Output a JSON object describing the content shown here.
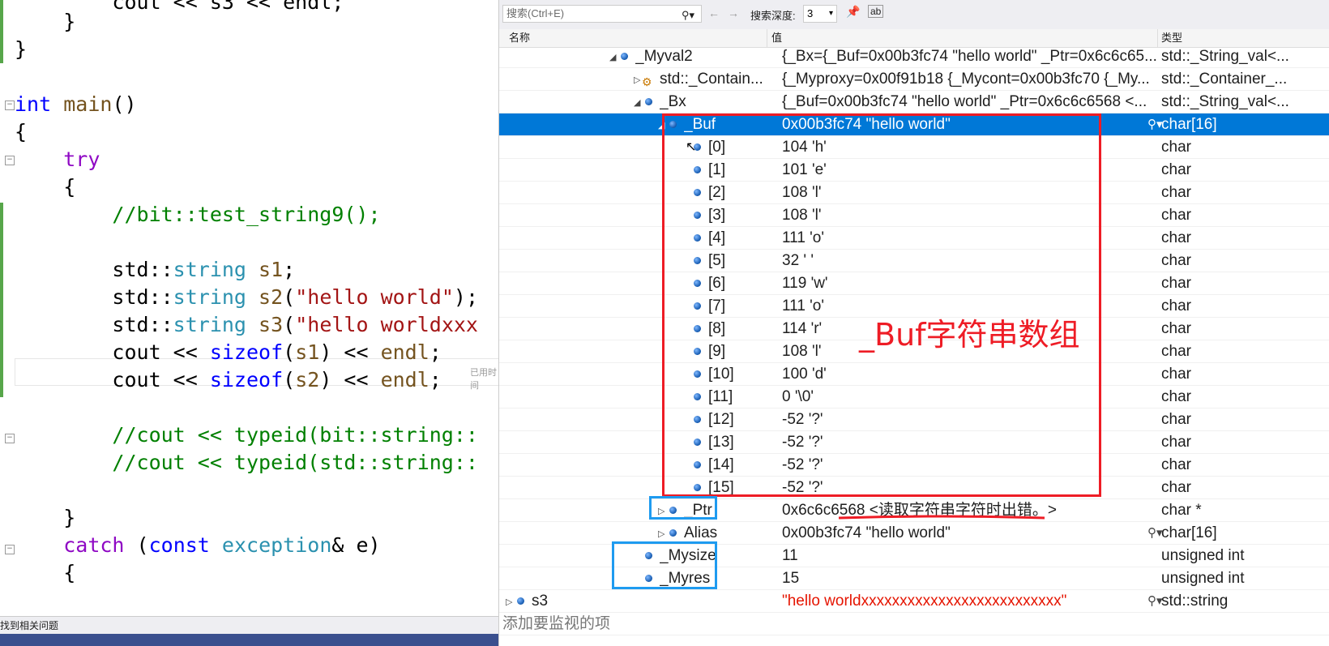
{
  "editor": {
    "lines": [
      {
        "text": "        cout << s3 << endl;"
      },
      {
        "text": "    }"
      },
      {
        "text": "}"
      },
      {
        "text": ""
      },
      {
        "text": "int main()"
      },
      {
        "text": "{"
      },
      {
        "text": "    try"
      },
      {
        "text": "    {"
      },
      {
        "text": "        //bit::test_string9();"
      },
      {
        "text": ""
      },
      {
        "text": "        std::string s1;"
      },
      {
        "text": "        std::string s2(\"hello world\");"
      },
      {
        "text": "        std::string s3(\"hello worldxxx"
      },
      {
        "text": "        cout << sizeof(s1) << endl;"
      },
      {
        "text": "        cout << sizeof(s2) << endl;"
      },
      {
        "text": ""
      },
      {
        "text": "        //cout << typeid(bit::string::"
      },
      {
        "text": "        //cout << typeid(std::string::"
      },
      {
        "text": ""
      },
      {
        "text": "    }"
      },
      {
        "text": "    catch (const exception& e)"
      },
      {
        "text": "    {"
      }
    ],
    "inline_hint": "已用时间",
    "status_text": "找到相关问题"
  },
  "watch": {
    "search_placeholder": "搜索(Ctrl+E)",
    "depth_label": "搜索深度:",
    "depth_value": "3",
    "columns": {
      "name": "名称",
      "value": "值",
      "type": "类型"
    },
    "rows": [
      {
        "name": "_Myval2",
        "value": "{_Bx={_Buf=0x00b3fc74 \"hello world\" _Ptr=0x6c6c65...",
        "type": "std::_String_val<..."
      },
      {
        "name": "std::_Contain...",
        "value": "{_Myproxy=0x00f91b18 {_Mycont=0x00b3fc70 {_My...",
        "type": "std::_Container_..."
      },
      {
        "name": "_Bx",
        "value": "{_Buf=0x00b3fc74 \"hello world\" _Ptr=0x6c6c6568 <...",
        "type": "std::_String_val<..."
      },
      {
        "name": "_Buf",
        "value": "0x00b3fc74 \"hello world\"",
        "type": "char[16]"
      },
      {
        "name": "[0]",
        "value": "104 'h'",
        "type": "char"
      },
      {
        "name": "[1]",
        "value": "101 'e'",
        "type": "char"
      },
      {
        "name": "[2]",
        "value": "108 'l'",
        "type": "char"
      },
      {
        "name": "[3]",
        "value": "108 'l'",
        "type": "char"
      },
      {
        "name": "[4]",
        "value": "111 'o'",
        "type": "char"
      },
      {
        "name": "[5]",
        "value": "32 ' '",
        "type": "char"
      },
      {
        "name": "[6]",
        "value": "119 'w'",
        "type": "char"
      },
      {
        "name": "[7]",
        "value": "111 'o'",
        "type": "char"
      },
      {
        "name": "[8]",
        "value": "114 'r'",
        "type": "char"
      },
      {
        "name": "[9]",
        "value": "108 'l'",
        "type": "char"
      },
      {
        "name": "[10]",
        "value": "100 'd'",
        "type": "char"
      },
      {
        "name": "[11]",
        "value": "0 '\\0'",
        "type": "char"
      },
      {
        "name": "[12]",
        "value": "-52 '?'",
        "type": "char"
      },
      {
        "name": "[13]",
        "value": "-52 '?'",
        "type": "char"
      },
      {
        "name": "[14]",
        "value": "-52 '?'",
        "type": "char"
      },
      {
        "name": "[15]",
        "value": "-52 '?'",
        "type": "char"
      },
      {
        "name": "_Ptr",
        "value": "0x6c6c6568 <读取字符串字符时出错。>",
        "type": "char *"
      },
      {
        "name": "Alias",
        "value": "0x00b3fc74 \"hello world\"",
        "type": "char[16]"
      },
      {
        "name": "_Mysize",
        "value": "11",
        "type": "unsigned int"
      },
      {
        "name": "_Myres",
        "value": "15",
        "type": "unsigned int"
      },
      {
        "name": "s3",
        "value": "\"hello worldxxxxxxxxxxxxxxxxxxxxxxxxxx\"",
        "type": "std::string"
      },
      {
        "name": "添加要监视的项",
        "value": "",
        "type": ""
      }
    ]
  },
  "annotation": {
    "text": "_Buf字符串数组"
  },
  "colors": {
    "selection": "#0078d7",
    "annotation_red": "#ee1c25",
    "annotation_blue": "#1e9bf0",
    "error_value": "#e51400"
  }
}
